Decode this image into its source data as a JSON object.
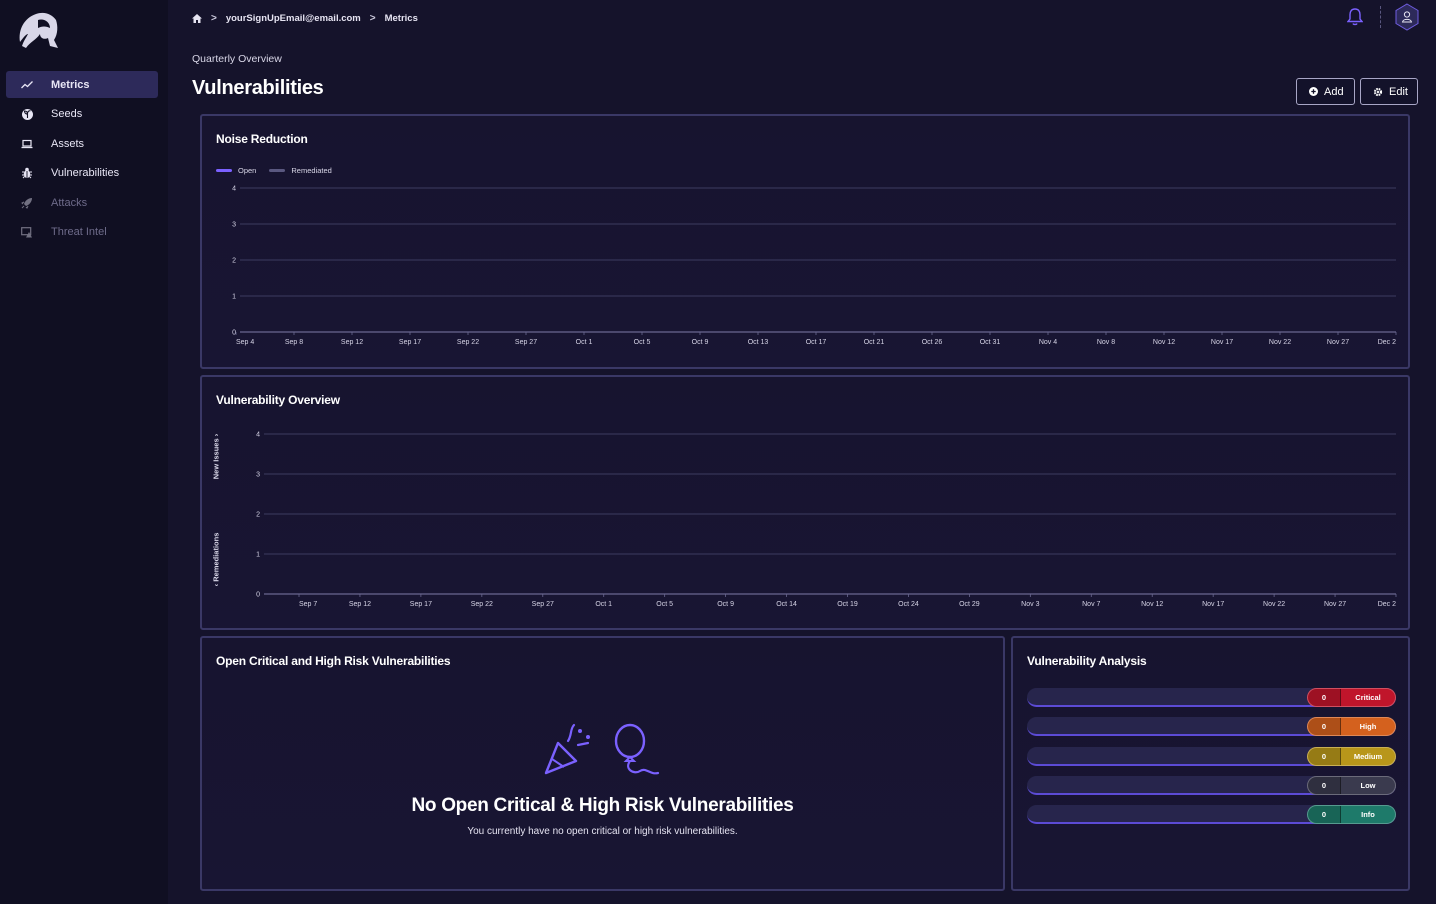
{
  "sidebar": {
    "items": [
      {
        "label": "Metrics",
        "icon": "trend-line-icon",
        "active": true,
        "disabled": false
      },
      {
        "label": "Seeds",
        "icon": "seedling-icon",
        "active": false,
        "disabled": false
      },
      {
        "label": "Assets",
        "icon": "laptop-icon",
        "active": false,
        "disabled": false
      },
      {
        "label": "Vulnerabilities",
        "icon": "bug-icon",
        "active": false,
        "disabled": false
      },
      {
        "label": "Attacks",
        "icon": "rocket-icon",
        "active": false,
        "disabled": true
      },
      {
        "label": "Threat Intel",
        "icon": "threat-intel-icon",
        "active": false,
        "disabled": true
      }
    ]
  },
  "breadcrumb": {
    "home_icon": "home-icon",
    "items": [
      "yourSignUpEmail@email.com",
      "Metrics"
    ],
    "separator": ">"
  },
  "header": {
    "subtitle": "Quarterly Overview",
    "title": "Vulnerabilities",
    "add_label": "Add",
    "edit_label": "Edit"
  },
  "cards": {
    "noise_reduction_title": "Noise Reduction",
    "vuln_overview_title": "Vulnerability Overview",
    "open_critical_title": "Open Critical and High Risk Vulnerabilities",
    "analysis_title": "Vulnerability Analysis"
  },
  "empty_state": {
    "title": "No Open Critical & High Risk Vulnerabilities",
    "message": "You currently have no open critical or high risk vulnerabilities."
  },
  "analysis": [
    {
      "count": "0",
      "label": "Critical",
      "color": "#c0152b"
    },
    {
      "count": "0",
      "label": "High",
      "color": "#d4611e"
    },
    {
      "count": "0",
      "label": "Medium",
      "color": "#b8961a"
    },
    {
      "count": "0",
      "label": "Low",
      "color": "#3a3a4e"
    },
    {
      "count": "0",
      "label": "Info",
      "color": "#1e7a6a"
    }
  ],
  "colors": {
    "accent": "#7b61ff",
    "background": "#15132b",
    "sidebar_active": "#2d2a5a"
  },
  "chart_data": [
    {
      "type": "line",
      "title": "Noise Reduction",
      "x": [
        "Sep 4",
        "Sep 8",
        "Sep 12",
        "Sep 17",
        "Sep 22",
        "Sep 27",
        "Oct 1",
        "Oct 5",
        "Oct 9",
        "Oct 13",
        "Oct 17",
        "Oct 21",
        "Oct 26",
        "Oct 31",
        "Nov 4",
        "Nov 8",
        "Nov 12",
        "Nov 17",
        "Nov 22",
        "Nov 27",
        "Dec 2"
      ],
      "series": [
        {
          "name": "Open",
          "color": "#7b61ff",
          "values": []
        },
        {
          "name": "Remediated",
          "color": "#5a5880",
          "values": []
        }
      ],
      "yticks": [
        0,
        1,
        2,
        3,
        4
      ],
      "ylim": [
        0,
        4
      ],
      "legend": "top-left",
      "grid": true
    },
    {
      "type": "line",
      "title": "Vulnerability Overview",
      "x": [
        "Sep 7",
        "Sep 12",
        "Sep 17",
        "Sep 22",
        "Sep 27",
        "Oct 1",
        "Oct 5",
        "Oct 9",
        "Oct 14",
        "Oct 19",
        "Oct 24",
        "Oct 29",
        "Nov 3",
        "Nov 7",
        "Nov 12",
        "Nov 17",
        "Nov 22",
        "Nov 27",
        "Dec 2"
      ],
      "yticks": [
        0,
        1,
        2,
        3,
        4
      ],
      "ylim": [
        0,
        4
      ],
      "side_labels": {
        "top": "New Issues",
        "bottom": "Remediations"
      },
      "grid": true
    }
  ]
}
